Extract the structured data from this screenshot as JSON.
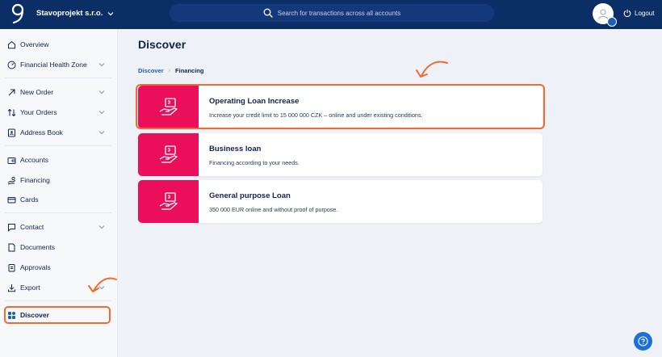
{
  "header": {
    "company": "Stavoprojekt s.r.o.",
    "search_placeholder": "Search for transactions across all accounts",
    "logout_label": "Logout"
  },
  "sidebar": {
    "items": [
      {
        "label": "Overview",
        "icon": "home-icon"
      },
      {
        "label": "Financial Health Zone",
        "icon": "gauge-icon"
      },
      {
        "label": "New Order",
        "icon": "arrow-up-right-icon"
      },
      {
        "label": "Your Orders",
        "icon": "transfer-arrows-icon"
      },
      {
        "label": "Address Book",
        "icon": "address-book-icon"
      },
      {
        "label": "Accounts",
        "icon": "wallet-icon"
      },
      {
        "label": "Financing",
        "icon": "hand-coin-icon"
      },
      {
        "label": "Cards",
        "icon": "card-icon"
      },
      {
        "label": "Contact",
        "icon": "chat-icon"
      },
      {
        "label": "Documents",
        "icon": "document-icon"
      },
      {
        "label": "Approvals",
        "icon": "clipboard-icon"
      },
      {
        "label": "Export",
        "icon": "download-icon"
      },
      {
        "label": "Discover",
        "icon": "grid-icon"
      }
    ]
  },
  "main": {
    "title": "Discover",
    "breadcrumb": {
      "link": "Discover",
      "separator": "›",
      "current": "Financing"
    },
    "cards": [
      {
        "title": "Operating Loan Increase",
        "description": "Increase your credit limit to 15 000 000 CZK – online and under existing conditions."
      },
      {
        "title": "Business loan",
        "description": "Financing according to your needs."
      },
      {
        "title": "General purpose Loan",
        "description": "350 000 EUR online and without proof of purpose."
      }
    ]
  },
  "colors": {
    "topbar": "#0b2e67",
    "accent_pink": "#eb0e5a",
    "highlight_orange": "#ef6a35",
    "link_blue": "#1d5fb8"
  }
}
